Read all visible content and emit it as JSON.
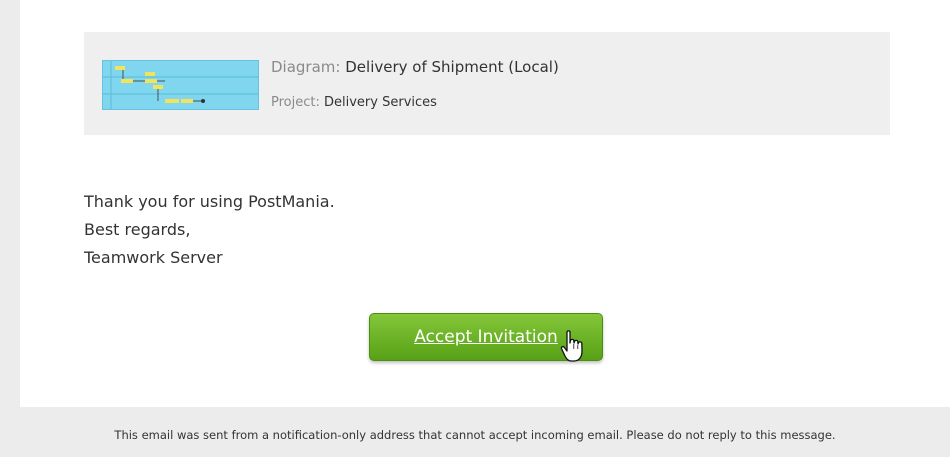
{
  "diagram_card": {
    "diagram_label": "Diagram:",
    "diagram_name": "Delivery of Shipment (Local)",
    "project_label": "Project:",
    "project_name": "Delivery Services",
    "thumbnail_color": "#7fd6ee"
  },
  "closing": {
    "line1": "Thank you for using PostMania.",
    "line2": "Best regards,",
    "line3": "Teamwork Server"
  },
  "button": {
    "label": "Accept Invitation",
    "color": "#6ab42a"
  },
  "cursor_icon": "hand-pointer-icon",
  "footer": {
    "note": "This email was sent from a notification-only address that cannot accept incoming email. Please do not reply to this message."
  }
}
